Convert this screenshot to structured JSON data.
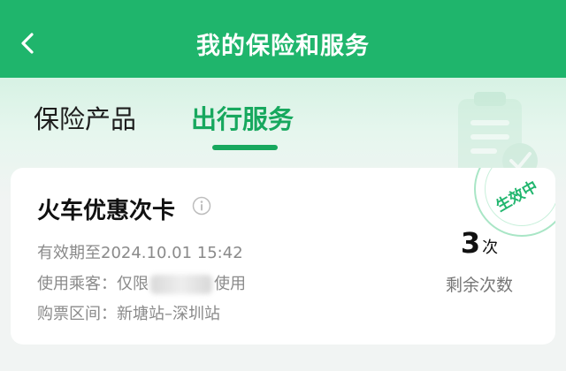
{
  "header": {
    "title": "我的保险和服务",
    "back_icon": "chevron-left-icon"
  },
  "tabs": [
    {
      "label": "保险产品",
      "active": false
    },
    {
      "label": "出行服务",
      "active": true
    }
  ],
  "card": {
    "title": "火车优惠次卡",
    "info_icon": "info-icon",
    "status_stamp": "生效中",
    "validity": "有效期至2024.10.01 15:42",
    "passenger_label": "使用乘客：",
    "passenger_prefix": "仅限",
    "passenger_suffix": "使用",
    "route": "购票区间：新塘站–深圳站",
    "remaining": {
      "count": "3",
      "unit": "次",
      "label": "剩余次数"
    }
  },
  "colors": {
    "brand_green": "#1fb56c",
    "accent_green": "#17a85e",
    "muted_text": "#8a8a8a"
  }
}
